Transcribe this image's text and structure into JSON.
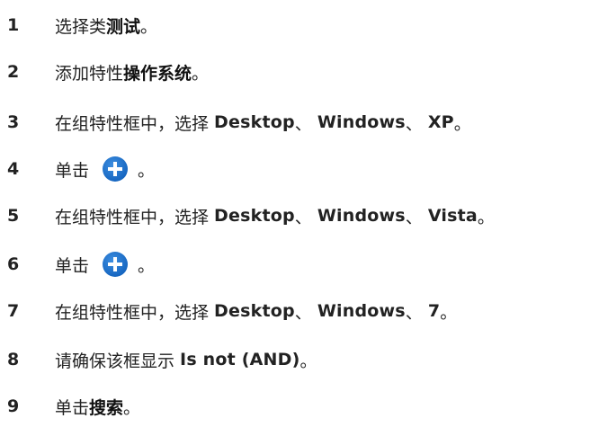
{
  "steps": [
    {
      "number": "1",
      "segments": [
        {
          "text": "选择类",
          "style": "normal"
        },
        {
          "text": "测试",
          "style": "bold"
        },
        {
          "text": "。",
          "style": "normal"
        }
      ]
    },
    {
      "number": "2",
      "segments": [
        {
          "text": "添加特性",
          "style": "normal"
        },
        {
          "text": "操作系统",
          "style": "bold"
        },
        {
          "text": "。",
          "style": "normal"
        }
      ]
    },
    {
      "number": "3",
      "segments": [
        {
          "text": "在组特性框中，选择 ",
          "style": "normal"
        },
        {
          "text": "Desktop",
          "style": "label"
        },
        {
          "text": "、 ",
          "style": "normal"
        },
        {
          "text": "Windows",
          "style": "label"
        },
        {
          "text": "、 ",
          "style": "normal"
        },
        {
          "text": "XP",
          "style": "label"
        },
        {
          "text": "。",
          "style": "normal"
        }
      ]
    },
    {
      "number": "4",
      "segments": [
        {
          "text": "单击",
          "style": "normal"
        },
        {
          "icon": "plus-circle-icon"
        },
        {
          "text": "。",
          "style": "normal"
        }
      ]
    },
    {
      "number": "5",
      "segments": [
        {
          "text": "在组特性框中，选择 ",
          "style": "normal"
        },
        {
          "text": "Desktop",
          "style": "label"
        },
        {
          "text": "、 ",
          "style": "normal"
        },
        {
          "text": "Windows",
          "style": "label"
        },
        {
          "text": "、 ",
          "style": "normal"
        },
        {
          "text": "Vista",
          "style": "label"
        },
        {
          "text": "。",
          "style": "normal"
        }
      ]
    },
    {
      "number": "6",
      "segments": [
        {
          "text": "单击",
          "style": "normal"
        },
        {
          "icon": "plus-circle-icon"
        },
        {
          "text": "。",
          "style": "normal"
        }
      ]
    },
    {
      "number": "7",
      "segments": [
        {
          "text": "在组特性框中，选择 ",
          "style": "normal"
        },
        {
          "text": "Desktop",
          "style": "label"
        },
        {
          "text": "、 ",
          "style": "normal"
        },
        {
          "text": "Windows",
          "style": "label"
        },
        {
          "text": "、 ",
          "style": "normal"
        },
        {
          "text": "7",
          "style": "label"
        },
        {
          "text": "。",
          "style": "normal"
        }
      ]
    },
    {
      "number": "8",
      "segments": [
        {
          "text": "请确保该框显示 ",
          "style": "normal"
        },
        {
          "text": "Is not (AND)",
          "style": "label"
        },
        {
          "text": "。",
          "style": "normal"
        }
      ]
    },
    {
      "number": "9",
      "segments": [
        {
          "text": "单击",
          "style": "normal"
        },
        {
          "text": "搜索",
          "style": "bold"
        },
        {
          "text": "。",
          "style": "normal"
        }
      ]
    }
  ],
  "colors": {
    "icon_blue": "#1565c0",
    "icon_blue_light": "#3d8ee0",
    "text": "#222222"
  }
}
